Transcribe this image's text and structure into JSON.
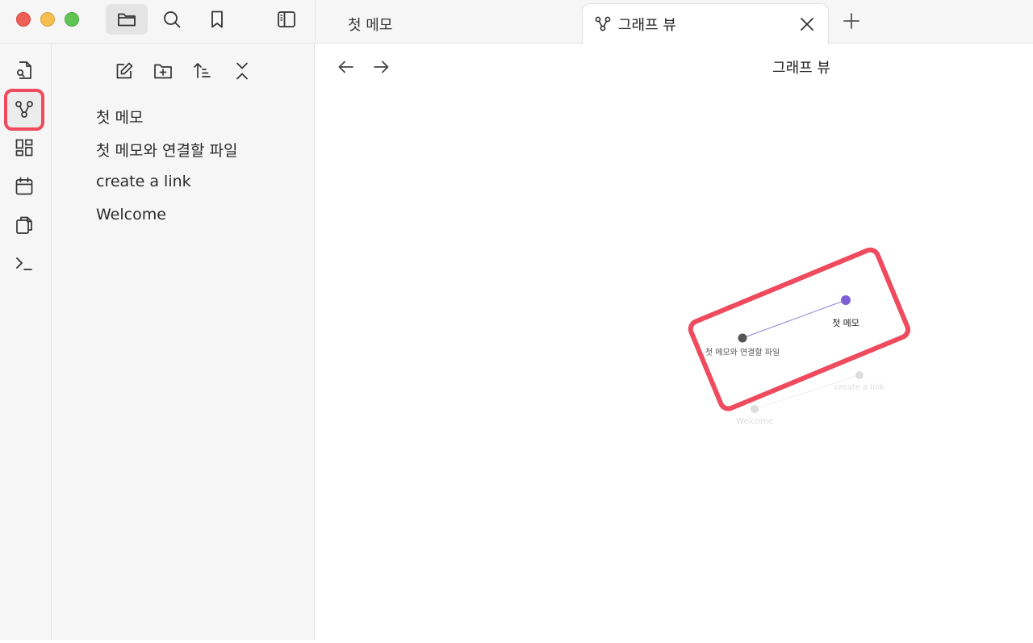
{
  "window": {
    "controls": [
      "close",
      "minimize",
      "zoom"
    ]
  },
  "toolbar": {
    "buttons": [
      {
        "icon": "folder-icon",
        "active": true
      },
      {
        "icon": "search-icon",
        "active": false
      },
      {
        "icon": "bookmark-icon",
        "active": false
      },
      {
        "icon": "sidebar-toggle-icon",
        "active": false
      }
    ]
  },
  "tabs": [
    {
      "label": "첫 메모",
      "active": false
    },
    {
      "label": "그래프 뷰",
      "active": true,
      "icon": "graph-icon"
    }
  ],
  "ribbon": {
    "items": [
      {
        "icon": "file-search-icon"
      },
      {
        "icon": "graph-icon",
        "highlighted": true
      },
      {
        "icon": "canvas-icon"
      },
      {
        "icon": "calendar-icon"
      },
      {
        "icon": "copy-icon"
      },
      {
        "icon": "terminal-icon"
      }
    ],
    "highlight_color": "#ef4a5e"
  },
  "explorer": {
    "tools": [
      "new-note-icon",
      "new-folder-icon",
      "sort-icon",
      "collapse-icon"
    ],
    "files": [
      "첫 메모",
      "첫 메모와 연결할 파일",
      "create a link",
      "Welcome"
    ]
  },
  "view": {
    "title": "그래프 뷰"
  },
  "graph": {
    "nodes": [
      {
        "label": "첫 메모",
        "color": "#7b5fd6",
        "faded": false
      },
      {
        "label": "첫 메모와 연결할 파일",
        "color": "#555555",
        "faded": false
      },
      {
        "label": "create a link",
        "color": "#dddddd",
        "faded": true
      },
      {
        "label": "Welcome",
        "color": "#dddddd",
        "faded": true
      }
    ],
    "link_color": "#8b7fd6",
    "highlight_color": "#ef4a5e"
  }
}
